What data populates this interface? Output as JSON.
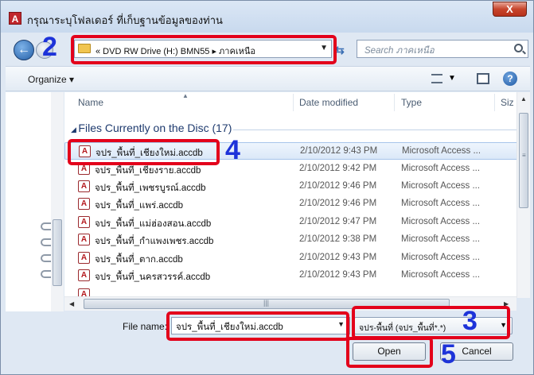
{
  "window": {
    "title": "กรุณาระบุโฟลเดอร์ ที่เก็บฐานข้อมูลของท่าน",
    "app_icon": "A",
    "close": "X"
  },
  "nav": {
    "breadcrumb": "«  DVD RW Drive (H:) BMN55  ▸  ภาคเหนือ",
    "search_placeholder": "Search ภาคเหนือ"
  },
  "toolbar": {
    "organize_label": "Organize ▾",
    "help": "?"
  },
  "columns": {
    "name": "Name",
    "date": "Date modified",
    "type": "Type",
    "size": "Siz"
  },
  "group": {
    "label": "Files Currently on the Disc (17)"
  },
  "files": [
    {
      "name": "จปร_พื้นที่_เชียงใหม่.accdb",
      "date": "2/10/2012 9:43 PM",
      "type": "Microsoft Access ..."
    },
    {
      "name": "จปร_พื้นที่_เชียงราย.accdb",
      "date": "2/10/2012 9:42 PM",
      "type": "Microsoft Access ..."
    },
    {
      "name": "จปร_พื้นที่_เพชรบูรณ์.accdb",
      "date": "2/10/2012 9:46 PM",
      "type": "Microsoft Access ..."
    },
    {
      "name": "จปร_พื้นที่_แพร่.accdb",
      "date": "2/10/2012 9:46 PM",
      "type": "Microsoft Access ..."
    },
    {
      "name": "จปร_พื้นที่_แม่ฮ่องสอน.accdb",
      "date": "2/10/2012 9:47 PM",
      "type": "Microsoft Access ..."
    },
    {
      "name": "จปร_พื้นที่_กำแพงเพชร.accdb",
      "date": "2/10/2012 9:38 PM",
      "type": "Microsoft Access ..."
    },
    {
      "name": "จปร_พื้นที่_ตาก.accdb",
      "date": "2/10/2012 9:43 PM",
      "type": "Microsoft Access ..."
    },
    {
      "name": "จปร_พื้นที่_นครสวรรค์.accdb",
      "date": "2/10/2012 9:43 PM",
      "type": "Microsoft Access ..."
    }
  ],
  "footer": {
    "file_name_label": "File name:",
    "file_name_value": "จปร_พื้นที่_เชียงใหม่.accdb",
    "filter_value": "จปร-พื้นที่ (จปร_พื้นที่*.*)",
    "open_label": "Open",
    "cancel_label": "Cancel"
  },
  "annotations": {
    "step2": "2",
    "step3": "3",
    "step4": "4",
    "step5": "5",
    "color": "#e3001b",
    "number_color": "#1d33d9"
  }
}
